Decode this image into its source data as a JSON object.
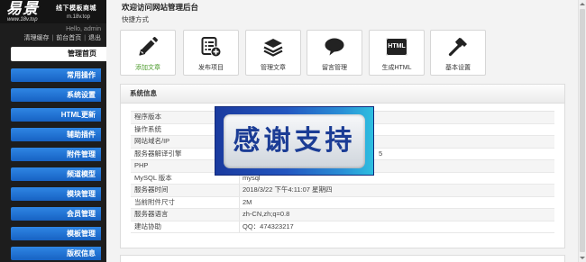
{
  "logo": {
    "brand": "易景",
    "site": "www.18v.top",
    "slogan": "线下模板商城",
    "mobile": "m.18v.top"
  },
  "user": {
    "greeting": "Hello, admin",
    "links": [
      "清理缓存",
      "前台首页",
      "退出"
    ],
    "sep": "|"
  },
  "menu": [
    {
      "label": "管理首页",
      "active": true
    },
    {
      "label": "常用操作"
    },
    {
      "label": "系统设置"
    },
    {
      "label": "HTML更新"
    },
    {
      "label": "辅助插件"
    },
    {
      "label": "附件管理"
    },
    {
      "label": "频道模型"
    },
    {
      "label": "模块管理"
    },
    {
      "label": "会员管理"
    },
    {
      "label": "模板管理"
    },
    {
      "label": "版权信息"
    }
  ],
  "header": {
    "title": "欢迎访问网站管理后台",
    "shortcuts_label": "快捷方式"
  },
  "shortcuts": [
    {
      "label": "添加文章",
      "icon": "pencil-icon"
    },
    {
      "label": "发布项目",
      "icon": "list-add-icon"
    },
    {
      "label": "管理文章",
      "icon": "stack-icon"
    },
    {
      "label": "留言管理",
      "icon": "speech-bubble-icon"
    },
    {
      "label": "生成HTML",
      "icon": "html-icon",
      "icon_text": "HTML"
    },
    {
      "label": "基本设置",
      "icon": "hammer-icon"
    }
  ],
  "sysinfo": {
    "title": "系统信息",
    "rows": [
      {
        "label": "程序版本",
        "value": ""
      },
      {
        "label": "操作系统",
        "value": ""
      },
      {
        "label": "网站域名/IP",
        "value": ""
      },
      {
        "label": "服务器解译引擎",
        "value": "5"
      },
      {
        "label": "PHP",
        "value": ""
      },
      {
        "label": "MySQL 版本",
        "value": "mysql"
      },
      {
        "label": "服务器时间",
        "value": "2018/3/22 下午4:11:07 星期四"
      },
      {
        "label": "当前附件尺寸",
        "value": "2M"
      },
      {
        "label": "服务器语言",
        "value": "zh-CN,zh;q=0.8"
      },
      {
        "label": "建站协助",
        "value": "QQ：474323217"
      }
    ]
  },
  "overlay": {
    "text": "感谢支持"
  },
  "colors": {
    "sidebar": "#1d1d1d",
    "menu_blue": "#1d6fd0",
    "shortcut_accent_green": "#4b9b2b",
    "overlay_text": "#1b3c95"
  }
}
